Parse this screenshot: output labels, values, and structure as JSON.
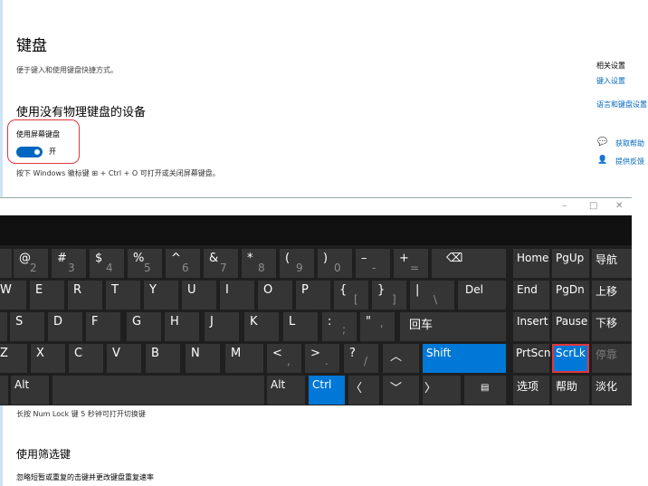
{
  "settings": {
    "title": "键盘",
    "subtitle": "便于键入和使用键盘快捷方式。",
    "section1_heading": "使用没有物理键盘的设备",
    "toggle_label": "使用屏幕键盘",
    "toggle_state": "开",
    "hint1": "按下 Windows 徽标键 ⊞ + Ctrl + O 可打开或关闭屏幕键盘。",
    "hint2": "长按 Num Lock 键 5 秒钟可打开切换键",
    "section2_heading": "使用筛选键",
    "section2_desc": "忽略短暂或重复的击键并更改键盘重复速率"
  },
  "sidebar": {
    "related_heading": "相关设置",
    "related_links": [
      "键入设置",
      "语言和键盘设置"
    ],
    "help_links": [
      "获取帮助",
      "提供反馈"
    ]
  },
  "osk": {
    "title_controls": {
      "minimize": "–",
      "maximize": "□",
      "close": "✕"
    },
    "keys": {
      "at": "@",
      "n2": "2",
      "hash": "#",
      "n3": "3",
      "dollar": "$",
      "n4": "4",
      "pct": "%",
      "n5": "5",
      "caret": "^",
      "n6": "6",
      "amp": "&",
      "n7": "7",
      "star": "*",
      "n8": "8",
      "lparen": "(",
      "n9": "9",
      "rparen": ")",
      "n0": "0",
      "minus": "–",
      "minus2": "-",
      "plus": "+",
      "eq": "=",
      "backspace": "⌫",
      "w": "W",
      "e": "E",
      "r": "R",
      "t": "T",
      "y": "Y",
      "u": "U",
      "i": "I",
      "o": "O",
      "p": "P",
      "lbrace": "{",
      "lbrack": "[",
      "rbrace": "}",
      "rbrack": "]",
      "pipe": "|",
      "bslash": "\\",
      "del": "Del",
      "s": "S",
      "d": "D",
      "f": "F",
      "g": "G",
      "h": "H",
      "j": "J",
      "k": "K",
      "l": "L",
      "colon": ":",
      "semicolon": ";",
      "quote": "\"",
      "apos": "'",
      "enter": "回车",
      "z": "Z",
      "x": "X",
      "c": "C",
      "v": "V",
      "b": "B",
      "n": "N",
      "m": "M",
      "lt": "<",
      "comma": ",",
      "gt": ">",
      "period": ".",
      "question": "?",
      "slash": "/",
      "up": "︿",
      "shift": "Shift",
      "alt_left": "Alt",
      "alt_right": "Alt",
      "ctrl": "Ctrl",
      "left": "〈",
      "down": "﹀",
      "right": "〉",
      "menu": "▤",
      "home": "Home",
      "pgup": "PgUp",
      "nav": "导航",
      "end": "End",
      "pgdn": "PgDn",
      "moveup": "上移",
      "insert": "Insert",
      "pause": "Pause",
      "movedown": "下移",
      "prtscn": "PrtScn",
      "scrlk": "ScrLk",
      "dock": "停靠",
      "options": "选项",
      "help": "帮助",
      "fade": "淡化"
    }
  },
  "colors": {
    "accent": "#0078d7",
    "highlight_border": "#e0373c",
    "key_bg": "#353535",
    "keyboard_bg": "#1f1f1f"
  }
}
